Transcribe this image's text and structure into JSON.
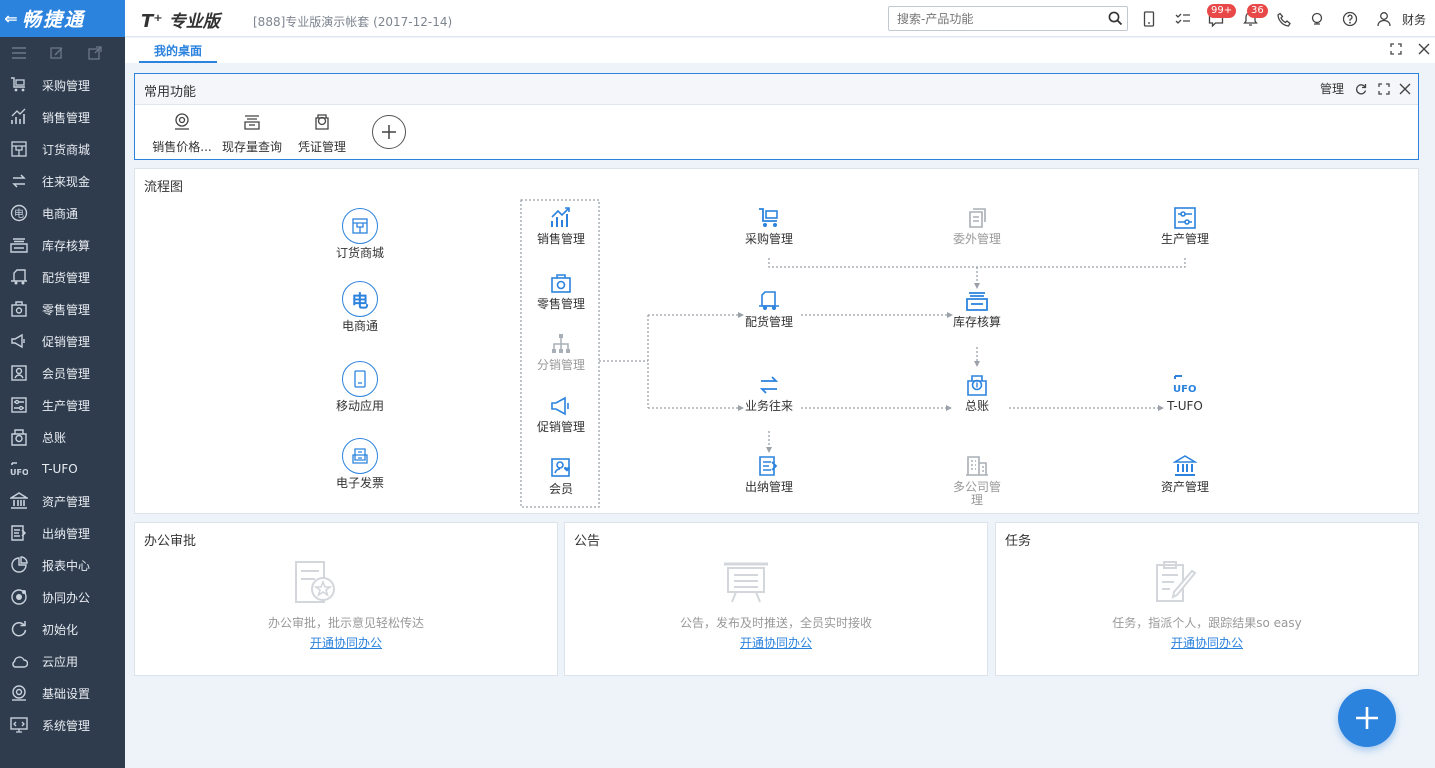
{
  "app": {
    "logo": "畅捷通",
    "product": "专业版",
    "product_prefix": "T⁺",
    "account": "[888]专业版演示帐套  (2017-12-14)",
    "user": "财务"
  },
  "search": {
    "placeholder": "搜索-产品功能"
  },
  "badges": {
    "messages": "99+",
    "notifications": "36"
  },
  "tabs": {
    "desktop": "我的桌面"
  },
  "nav": [
    {
      "label": "采购管理",
      "icon": "cart-icon"
    },
    {
      "label": "销售管理",
      "icon": "chart-icon"
    },
    {
      "label": "订货商城",
      "icon": "store-icon"
    },
    {
      "label": "往来现金",
      "icon": "exchange-icon"
    },
    {
      "label": "电商通",
      "icon": "ecommerce-icon"
    },
    {
      "label": "库存核算",
      "icon": "inventory-icon"
    },
    {
      "label": "配货管理",
      "icon": "truck-icon"
    },
    {
      "label": "零售管理",
      "icon": "retail-icon"
    },
    {
      "label": "促销管理",
      "icon": "megaphone-icon"
    },
    {
      "label": "会员管理",
      "icon": "member-icon"
    },
    {
      "label": "生产管理",
      "icon": "production-icon"
    },
    {
      "label": "总账",
      "icon": "ledger-icon"
    },
    {
      "label": "T-UFO",
      "icon": "ufo-icon"
    },
    {
      "label": "资产管理",
      "icon": "bank-icon"
    },
    {
      "label": "出纳管理",
      "icon": "cashier-icon"
    },
    {
      "label": "报表中心",
      "icon": "pie-icon"
    },
    {
      "label": "协同办公",
      "icon": "collab-icon"
    },
    {
      "label": "初始化",
      "icon": "refresh-icon"
    },
    {
      "label": "云应用",
      "icon": "cloud-icon"
    },
    {
      "label": "基础设置",
      "icon": "settings-icon"
    },
    {
      "label": "系统管理",
      "icon": "system-icon"
    }
  ],
  "common": {
    "title": "常用功能",
    "manage": "管理",
    "items": [
      {
        "label": "销售价格...",
        "icon": "price-icon"
      },
      {
        "label": "现存量查询",
        "icon": "stock-query-icon"
      },
      {
        "label": "凭证管理",
        "icon": "voucher-icon"
      }
    ]
  },
  "flow": {
    "title": "流程图",
    "left": [
      "订货商城",
      "电商通",
      "移动应用",
      "电子发票"
    ],
    "middle": [
      "销售管理",
      "零售管理",
      "分销管理",
      "促销管理",
      "会员"
    ],
    "right": {
      "purchase": "采购管理",
      "outsource": "委外管理",
      "production": "生产管理",
      "distribution": "配货管理",
      "inventory": "库存核算",
      "business": "业务往来",
      "ledger": "总账",
      "tufo": "T-UFO",
      "cashier": "出纳管理",
      "multicompany": "多公司管理",
      "assets": "资产管理"
    }
  },
  "approval": {
    "title": "办公审批",
    "text": "办公审批，批示意见轻松传达",
    "link": "开通协同办公"
  },
  "notice": {
    "title": "公告",
    "text": "公告，发布及时推送，全员实时接收",
    "link": "开通协同办公"
  },
  "tasks": {
    "title": "任务",
    "text": "任务，指派个人，跟踪结果so easy",
    "link": "开通协同办公"
  },
  "colors": {
    "accent": "#2c83de",
    "sidebar": "#2f3c4e",
    "badge": "#e84848"
  }
}
